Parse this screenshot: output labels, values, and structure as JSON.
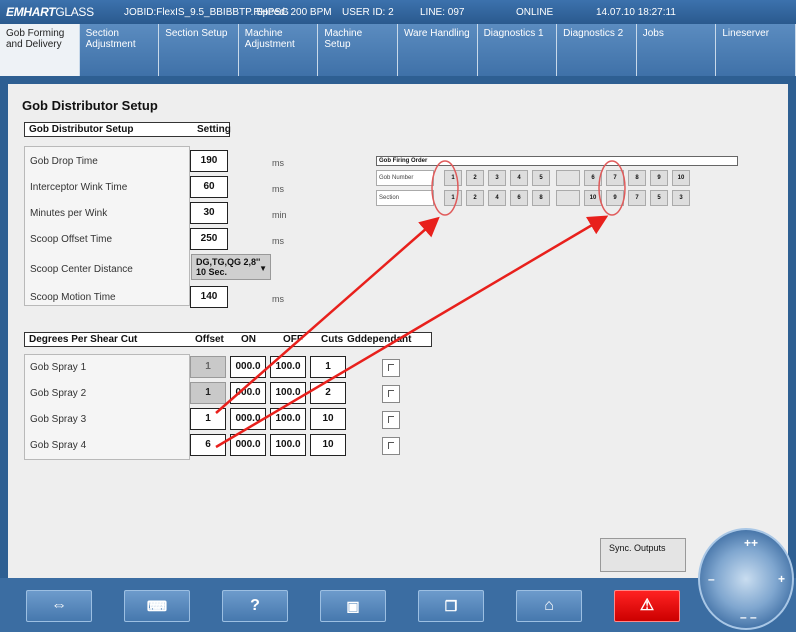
{
  "topbar": {
    "logo_bold": "EMHART",
    "logo_thin": "GLASS",
    "jobid": "JOBID:FlexIS_9.5_BBIBBTP.RHPSG",
    "speed": "Speed: 200 BPM",
    "user": "USER ID: 2",
    "line": "LINE: 097",
    "status": "ONLINE",
    "datetime": "14.07.10 18:27:11"
  },
  "tabs": [
    "Gob Forming and Delivery",
    "Section Adjustment",
    "Section Setup",
    "Machine Adjustment",
    "Machine Setup",
    "Ware Handling",
    "Diagnostics 1",
    "Diagnostics 2",
    "Jobs",
    "Lineserver"
  ],
  "page_title": "Gob Distributor Setup",
  "setup": {
    "header": "Gob Distributor Setup",
    "setting_header": "Setting",
    "rows": [
      {
        "label": "Gob Drop Time",
        "value": "190",
        "unit": "ms"
      },
      {
        "label": "Interceptor Wink Time",
        "value": "60",
        "unit": "ms"
      },
      {
        "label": "Minutes per Wink",
        "value": "30",
        "unit": "min"
      },
      {
        "label": "Scoop Offset Time",
        "value": "250",
        "unit": "ms"
      },
      {
        "label": "Scoop Center Distance",
        "value": "DG,TG,QG 2,8'' 10 Sec.",
        "unit": ""
      },
      {
        "label": "Scoop Motion Time",
        "value": "140",
        "unit": "ms"
      }
    ]
  },
  "firing_order": {
    "title": "Gob Firing Order",
    "row1_label": "Gob Number",
    "row2_label": "Section",
    "gob_numbers": [
      "1",
      "2",
      "3",
      "4",
      "5",
      "6",
      "7",
      "8",
      "9",
      "10"
    ],
    "sections": [
      "1",
      "2",
      "4",
      "6",
      "8",
      "10",
      "9",
      "7",
      "5",
      "3"
    ],
    "highlight_color": "#e05a5a"
  },
  "shear": {
    "header": "Degrees Per Shear Cut",
    "col_offset": "Offset",
    "col_on": "ON",
    "col_off": "OFF",
    "col_cuts": "Cuts",
    "col_dep": "Gddependant",
    "rows": [
      {
        "label": "Gob Spray 1",
        "offset": "1",
        "on": "000.0",
        "off": "100.0",
        "cuts": "1"
      },
      {
        "label": "Gob Spray 2",
        "offset": "1",
        "on": "000.0",
        "off": "100.0",
        "cuts": "2"
      },
      {
        "label": "Gob Spray 3",
        "offset": "1",
        "on": "000.0",
        "off": "100.0",
        "cuts": "10"
      },
      {
        "label": "Gob Spray 4",
        "offset": "6",
        "on": "000.0",
        "off": "100.0",
        "cuts": "10"
      }
    ]
  },
  "sync_button": "Sync. Outputs",
  "bottom_icons": [
    "back-forward-icon",
    "keyboard-icon",
    "help-icon",
    "camera-icon",
    "copy-icon",
    "home-icon",
    "alarm-icon"
  ],
  "arrow_color": "#e8201c"
}
